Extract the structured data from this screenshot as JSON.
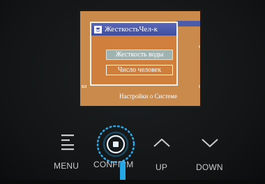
{
  "screen": {
    "background_fragments": {
      "right_top": "ей",
      "right_bottom": "я",
      "left": "ка",
      "bottom": "Настройки    о Системе"
    },
    "dialog": {
      "title": "ЖесткостьЧел-к",
      "title_icon": "shower-icon",
      "options": [
        {
          "label": "Жесткость воды",
          "selected": true
        },
        {
          "label": "Число человек",
          "selected": false
        }
      ]
    }
  },
  "controls": {
    "menu": {
      "label": "MENU",
      "icon": "menu-icon"
    },
    "confirm": {
      "label": "CONFIRM",
      "icon": "confirm-icon"
    },
    "up": {
      "label": "UP",
      "icon": "chevron-up-icon"
    },
    "down": {
      "label": "DOWN",
      "icon": "chevron-down-icon"
    }
  },
  "colors": {
    "screen_bg": "#c98a4c",
    "title_bar": "#4a59a8",
    "selected_option": "#9fb3b0",
    "confirm_ring": "#29a9e8",
    "button_text": "#c9cbcc"
  }
}
